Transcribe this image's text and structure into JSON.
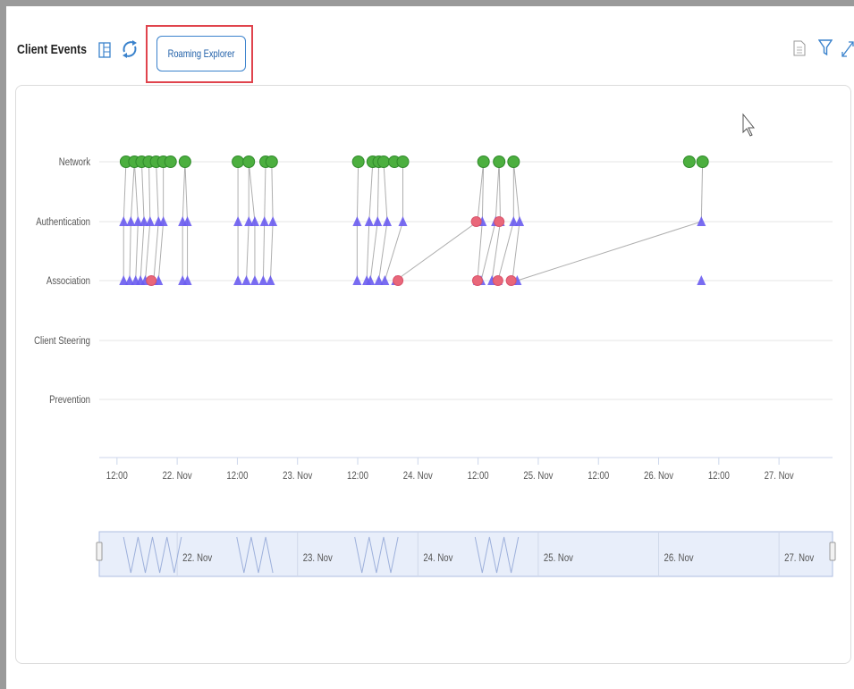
{
  "header": {
    "title": "Client Events",
    "roaming_button_label": "Roaming Explorer"
  },
  "chart_data": {
    "type": "scatter",
    "title": "",
    "ylabel": "",
    "xlabel": "",
    "categories": [
      "Network",
      "Authentication",
      "Association",
      "Client Steering",
      "Prevention"
    ],
    "x_ticks": [
      "12:00",
      "22. Nov",
      "12:00",
      "23. Nov",
      "12:00",
      "24. Nov",
      "12:00",
      "25. Nov",
      "12:00",
      "26. Nov",
      "12:00",
      "27. Nov"
    ],
    "xlim": [
      "2023-11-21 09:00",
      "2023-11-27 20:00"
    ],
    "grid": true,
    "legend": "none",
    "colors": {
      "network": "#4caf3f",
      "network_edge": "#2f8a2a",
      "success": "#6a5cf0",
      "failure": "#e9677a",
      "link": "#9a9a9a",
      "grid": "#e6e6e6"
    },
    "series": [
      {
        "name": "Network",
        "marker": "circle",
        "color": "#4caf3f",
        "x": [
          0.2,
          0.27,
          0.33,
          0.39,
          0.45,
          0.51,
          0.57,
          0.69,
          1.13,
          1.22,
          1.36,
          1.41,
          2.13,
          2.25,
          2.3,
          2.34,
          2.43,
          2.5,
          3.17,
          3.3,
          3.42,
          4.88,
          4.99
        ]
      },
      {
        "name": "Authentication",
        "marker": "triangle",
        "color": "#6a5cf0",
        "x": [
          0.18,
          0.24,
          0.3,
          0.35,
          0.4,
          0.47,
          0.51,
          0.67,
          0.71,
          1.13,
          1.22,
          1.27,
          1.35,
          1.42,
          2.12,
          2.22,
          2.29,
          2.37,
          2.5,
          3.12,
          3.16,
          3.27,
          3.31,
          3.42,
          3.47,
          4.98
        ]
      },
      {
        "name": "Authentication failures",
        "marker": "circle",
        "color": "#e9677a",
        "x": [
          3.11,
          3.3
        ]
      },
      {
        "name": "Association",
        "marker": "triangle",
        "color": "#6a5cf0",
        "x": [
          0.18,
          0.23,
          0.28,
          0.32,
          0.36,
          0.43,
          0.47,
          0.67,
          0.71,
          1.13,
          1.2,
          1.27,
          1.34,
          1.4,
          2.12,
          2.2,
          2.23,
          2.3,
          2.35,
          2.44,
          3.12,
          3.15,
          3.24,
          3.29,
          3.41,
          3.45,
          4.98
        ]
      },
      {
        "name": "Association failures",
        "marker": "circle",
        "color": "#e9677a",
        "x": [
          0.41,
          2.46,
          3.12,
          3.29,
          3.4
        ]
      },
      {
        "name": "Client Steering",
        "marker": "none",
        "x": []
      },
      {
        "name": "Prevention",
        "marker": "none",
        "x": []
      }
    ],
    "navigator": {
      "labels": [
        "22. Nov",
        "23. Nov",
        "24. Nov",
        "25. Nov",
        "26. Nov",
        "27. Nov"
      ]
    }
  }
}
